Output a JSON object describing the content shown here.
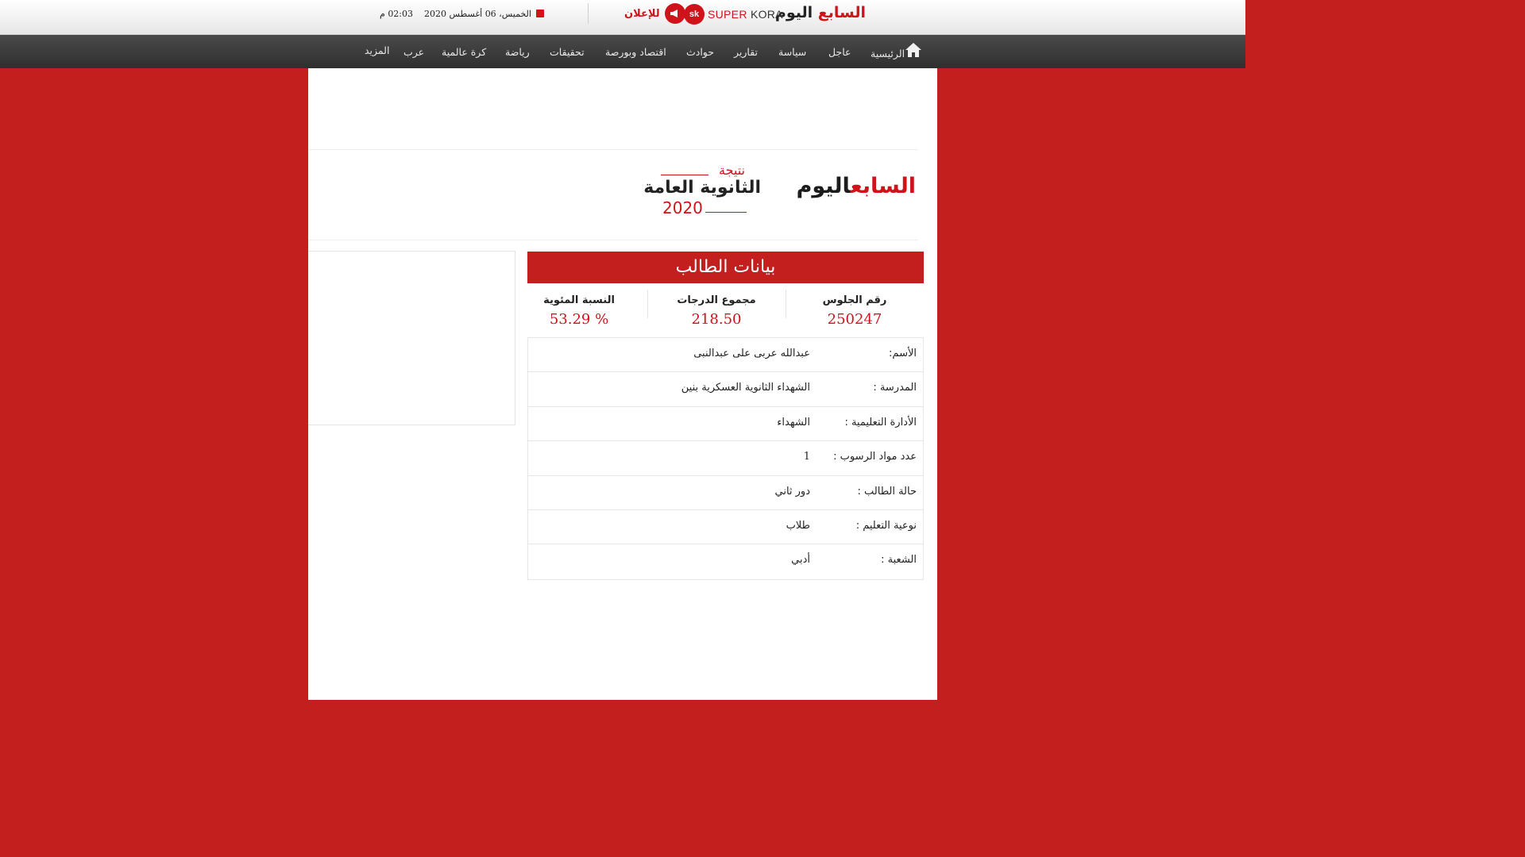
{
  "topbar": {
    "logo_prefix": "اليوم",
    "logo_suffix": "السابع",
    "superkora_badge": "sk",
    "superkora_brand_a": "SUPER",
    "superkora_brand_b": "KORA",
    "ad_label": "للإعلان",
    "date": "الخميس، 06 أغسطس 2020",
    "time": "02:03 م",
    "icons": [
      "calendar-icon",
      "megaphone-icon",
      "superkora-logo"
    ]
  },
  "nav": {
    "home": "الرئيسية",
    "items": [
      "عاجل",
      "سياسة",
      "تقارير",
      "حوادث",
      "اقتصاد وبورصة",
      "تحقيقات",
      "رياضة",
      "كرة عالمية",
      "عرب",
      "المزيد"
    ]
  },
  "header": {
    "logo_prefix": "اليوم",
    "logo_suffix": "السابع",
    "result_word": "نتيجة",
    "result_title": "الثانوية العامة",
    "result_year": "2020"
  },
  "student": {
    "panel_title": "بيانات الطالب",
    "stats": [
      {
        "label": "رقم الجلوس",
        "value": "250247"
      },
      {
        "label": "مجموع الدرجات",
        "value": "218.50"
      },
      {
        "label": "النسبة المئوية",
        "value": "53.29 %"
      }
    ],
    "rows": [
      {
        "key": "الأسم:",
        "value": "عبدالله عربى على عبدالنبى"
      },
      {
        "key": "المدرسة :",
        "value": "الشهداء الثانوية العسكرية بنين"
      },
      {
        "key": "الأدارة التعليمية :",
        "value": "الشهداء"
      },
      {
        "key": "عدد مواد الرسوب :",
        "value": "1"
      },
      {
        "key": "حالة الطالب :",
        "value": "دور ثاني"
      },
      {
        "key": "نوعية التعليم :",
        "value": "طلاب"
      },
      {
        "key": "الشعبة :",
        "value": "أدبي"
      }
    ]
  },
  "colors": {
    "brand_red": "#c31f1f",
    "accent_red": "#d0121b",
    "nav_dark": "#3a3a3a"
  }
}
